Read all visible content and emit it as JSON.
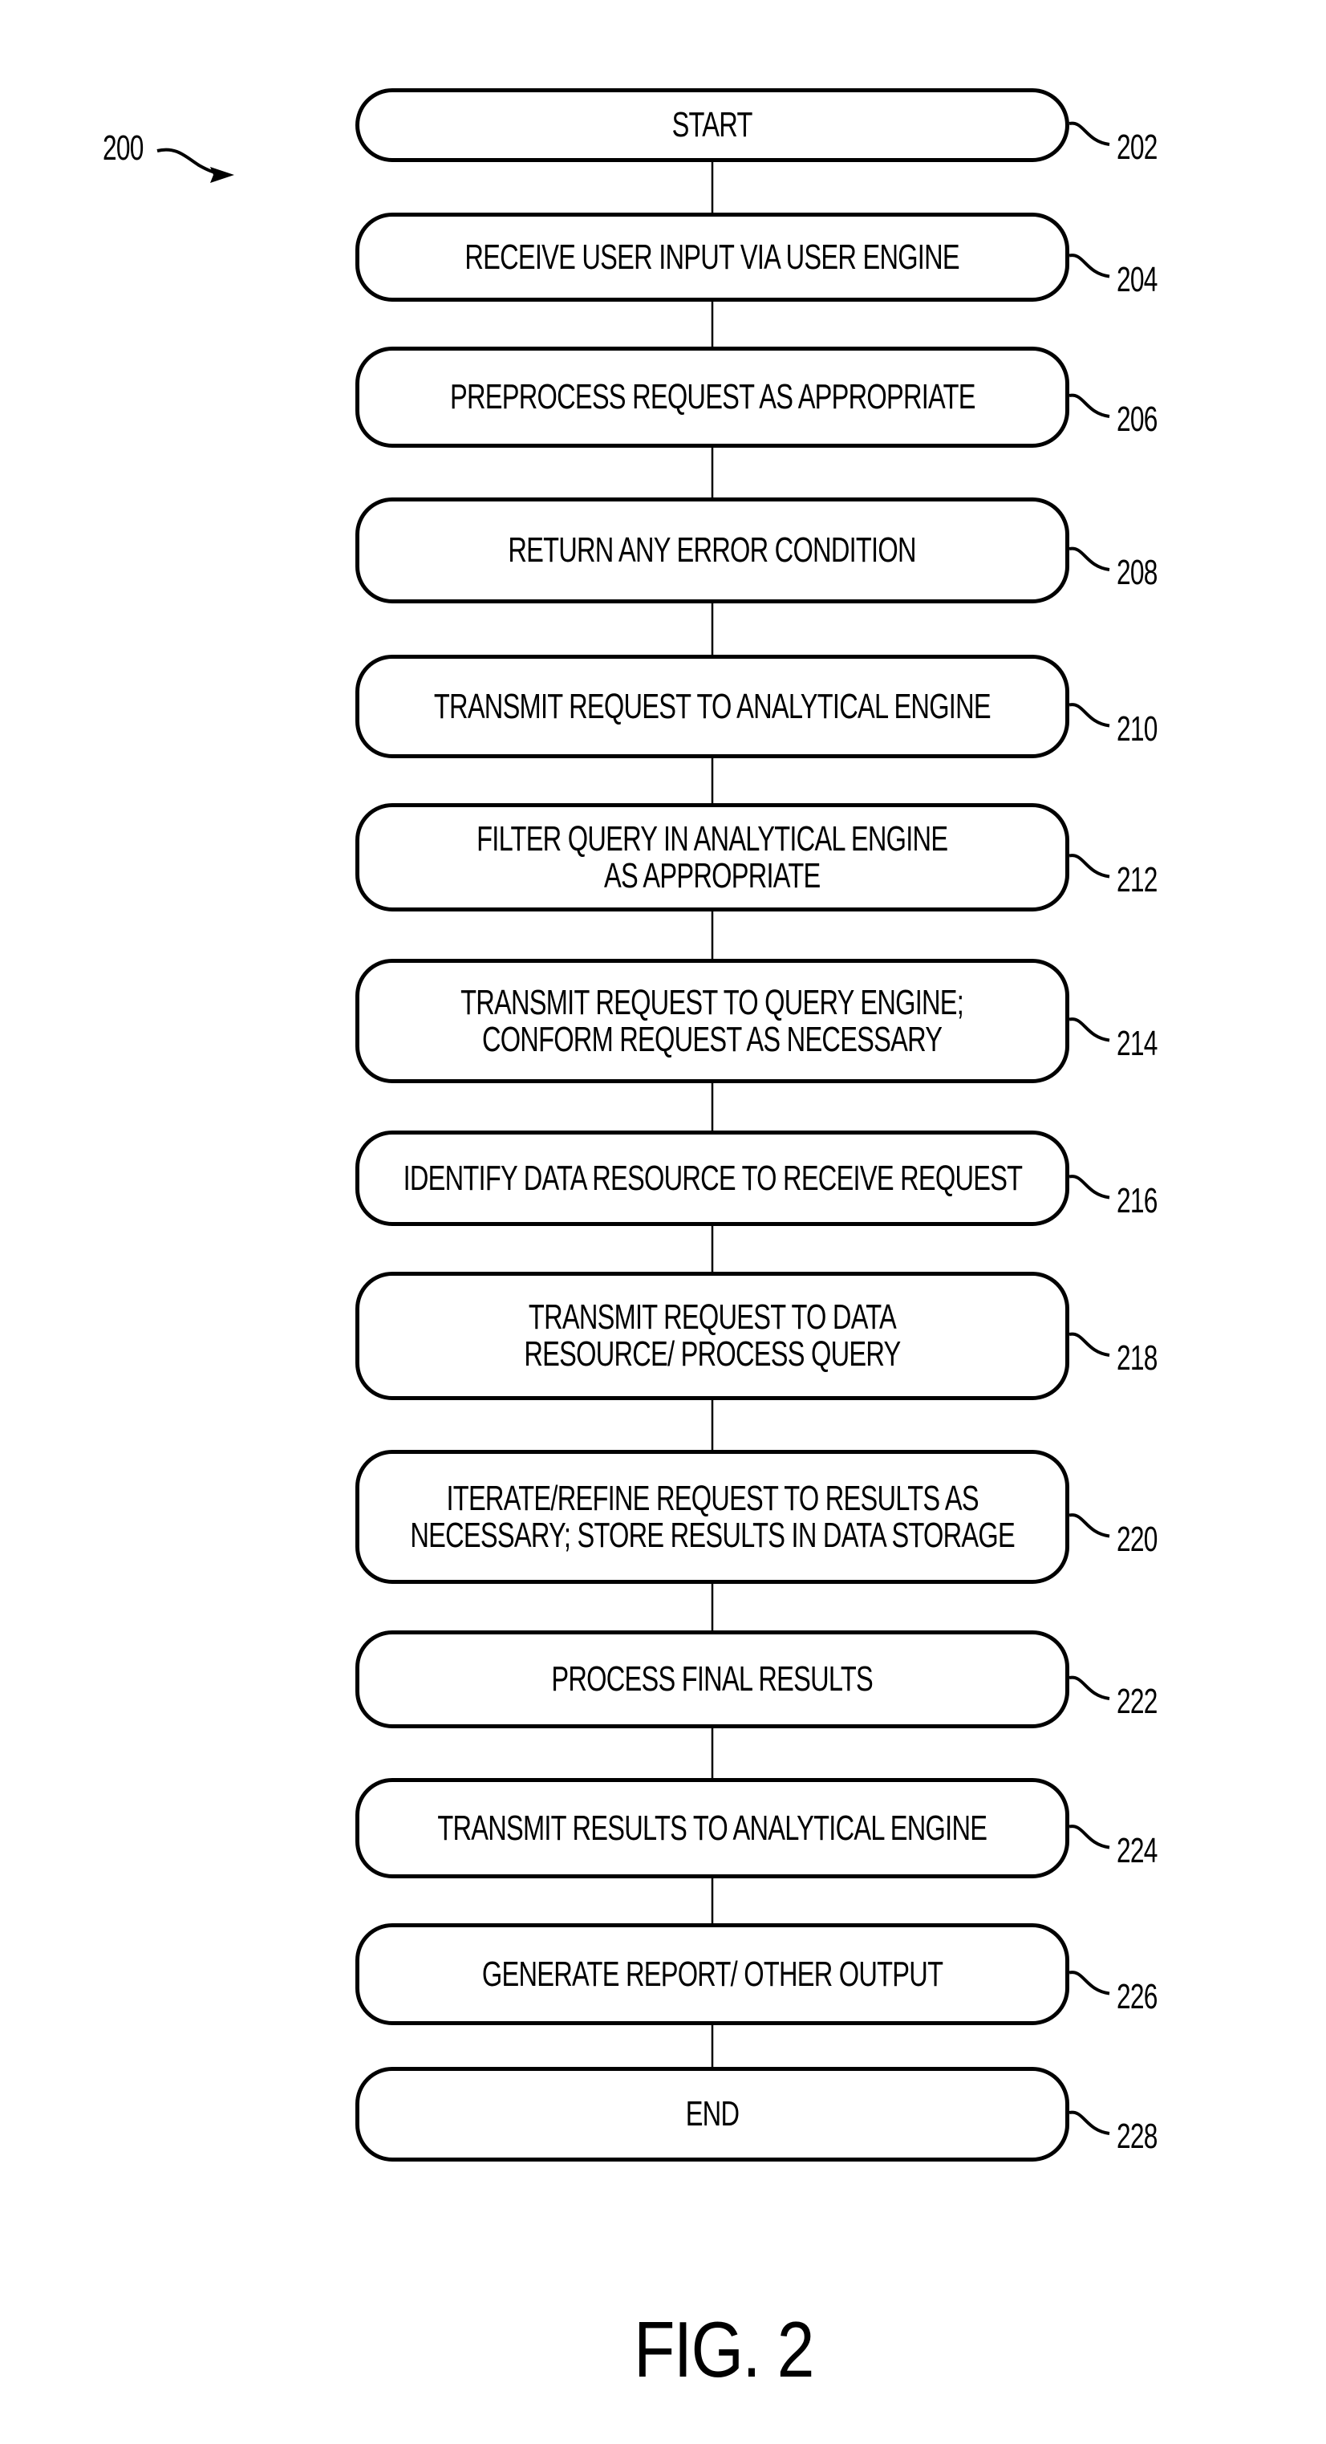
{
  "diagram": {
    "ref_label": "200",
    "figure_label": "FIG. 2",
    "steps": [
      {
        "ref": "202",
        "lines": [
          "START"
        ]
      },
      {
        "ref": "204",
        "lines": [
          "RECEIVE USER INPUT VIA USER ENGINE"
        ]
      },
      {
        "ref": "206",
        "lines": [
          "PREPROCESS REQUEST AS APPROPRIATE"
        ]
      },
      {
        "ref": "208",
        "lines": [
          "RETURN  ANY ERROR CONDITION"
        ]
      },
      {
        "ref": "210",
        "lines": [
          "TRANSMIT REQUEST TO ANALYTICAL ENGINE"
        ]
      },
      {
        "ref": "212",
        "lines": [
          "FILTER QUERY IN ANALYTICAL ENGINE",
          "AS APPROPRIATE"
        ]
      },
      {
        "ref": "214",
        "lines": [
          "TRANSMIT REQUEST TO QUERY ENGINE;",
          "CONFORM REQUEST AS NECESSARY"
        ]
      },
      {
        "ref": "216",
        "lines": [
          "IDENTIFY DATA RESOURCE TO RECEIVE REQUEST"
        ]
      },
      {
        "ref": "218",
        "lines": [
          "TRANSMIT REQUEST TO DATA",
          "RESOURCE/ PROCESS QUERY"
        ]
      },
      {
        "ref": "220",
        "lines": [
          "ITERATE/REFINE REQUEST TO RESULTS AS",
          "NECESSARY; STORE RESULTS IN DATA STORAGE"
        ]
      },
      {
        "ref": "222",
        "lines": [
          "PROCESS FINAL RESULTS"
        ]
      },
      {
        "ref": "224",
        "lines": [
          "TRANSMIT RESULTS TO ANALYTICAL ENGINE"
        ]
      },
      {
        "ref": "226",
        "lines": [
          "GENERATE REPORT/ OTHER OUTPUT"
        ]
      },
      {
        "ref": "228",
        "lines": [
          "END"
        ]
      }
    ]
  }
}
